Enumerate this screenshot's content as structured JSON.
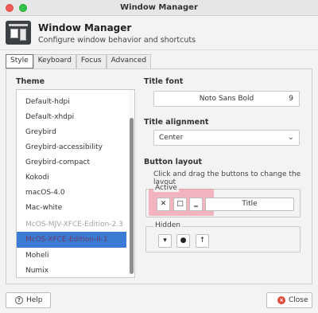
{
  "window": {
    "title": "Window Manager"
  },
  "header": {
    "title": "Window Manager",
    "subtitle": "Configure window behavior and shortcuts",
    "icon": "window-manager-icon"
  },
  "tabs": [
    {
      "label": "Style",
      "active": true
    },
    {
      "label": "Keyboard",
      "active": false
    },
    {
      "label": "Focus",
      "active": false
    },
    {
      "label": "Advanced",
      "active": false
    }
  ],
  "theme": {
    "label": "Theme",
    "items": [
      {
        "label": "Default-hdpi"
      },
      {
        "label": "Default-xhdpi"
      },
      {
        "label": "Greybird"
      },
      {
        "label": "Greybird-accessibility"
      },
      {
        "label": "Greybird-compact"
      },
      {
        "label": "Kokodi"
      },
      {
        "label": "macOS-4.0"
      },
      {
        "label": "Mac-white"
      },
      {
        "label": "McOS-MJV-XFCE-Edition-2.3"
      },
      {
        "label": "McOS-XFCE-Edition-II-1",
        "selected": true
      },
      {
        "label": "Moheli"
      },
      {
        "label": "Numix"
      }
    ]
  },
  "title_font": {
    "label": "Title font",
    "name": "Noto Sans Bold",
    "size": "9"
  },
  "title_alignment": {
    "label": "Title alignment",
    "value": "Center"
  },
  "button_layout": {
    "label": "Button layout",
    "description": "Click and drag the buttons to change the layout",
    "active_label": "Active",
    "hidden_label": "Hidden",
    "title_slot": "Title",
    "active_buttons": [
      {
        "glyph": "✕",
        "icon": "close-icon"
      },
      {
        "glyph": "□",
        "icon": "maximize-icon"
      },
      {
        "glyph": "‗",
        "icon": "minimize-icon"
      }
    ],
    "hidden_buttons": [
      {
        "glyph": "▾",
        "icon": "menu-icon"
      },
      {
        "glyph": "●",
        "icon": "stick-icon"
      },
      {
        "glyph": "↑",
        "icon": "shade-icon"
      }
    ]
  },
  "footer": {
    "help_label": "Help",
    "close_label": "Close"
  },
  "colors": {
    "selection": "#3a7bd5",
    "highlight": "#f08296",
    "close_red": "#e04a3b"
  }
}
